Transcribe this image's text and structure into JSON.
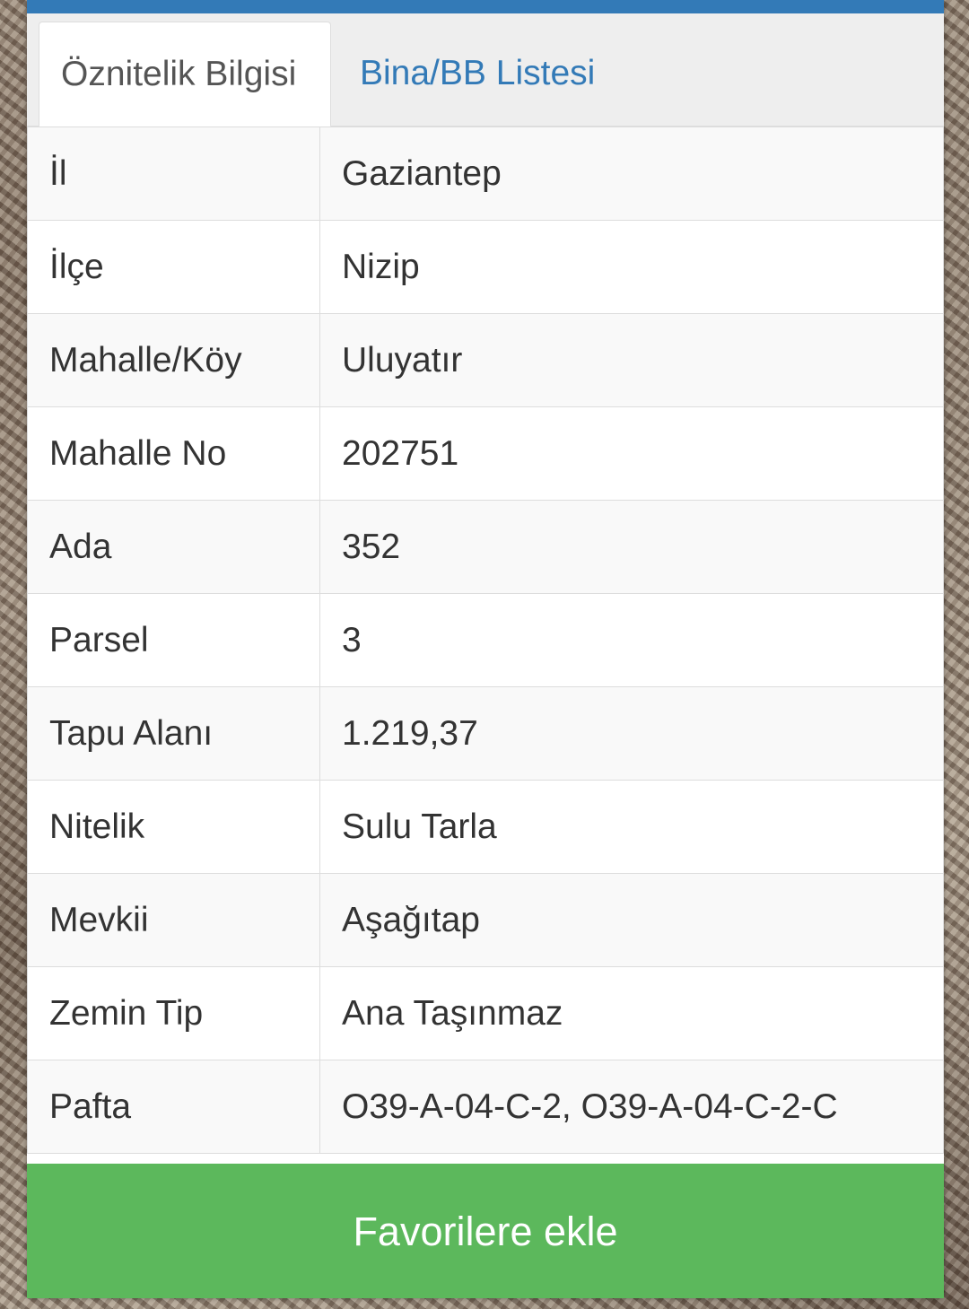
{
  "tabs": [
    {
      "label": "Öznitelik Bilgisi",
      "active": true
    },
    {
      "label": "Bina/BB Listesi",
      "active": false
    }
  ],
  "attributes": [
    {
      "key": "İl",
      "value": "Gaziantep"
    },
    {
      "key": "İlçe",
      "value": "Nizip"
    },
    {
      "key": "Mahalle/Köy",
      "value": "Uluyatır"
    },
    {
      "key": "Mahalle No",
      "value": "202751"
    },
    {
      "key": "Ada",
      "value": "352"
    },
    {
      "key": "Parsel",
      "value": "3"
    },
    {
      "key": "Tapu Alanı",
      "value": "1.219,37"
    },
    {
      "key": "Nitelik",
      "value": "Sulu Tarla"
    },
    {
      "key": "Mevkii",
      "value": "Aşağıtap"
    },
    {
      "key": "Zemin Tip",
      "value": "Ana Taşınmaz"
    },
    {
      "key": "Pafta",
      "value": "O39-A-04-C-2, O39-A-04-C-2-C"
    }
  ],
  "favorite_button": {
    "label": "Favorilere ekle"
  },
  "colors": {
    "accent": "#337ab7",
    "button": "#5cb85c"
  }
}
